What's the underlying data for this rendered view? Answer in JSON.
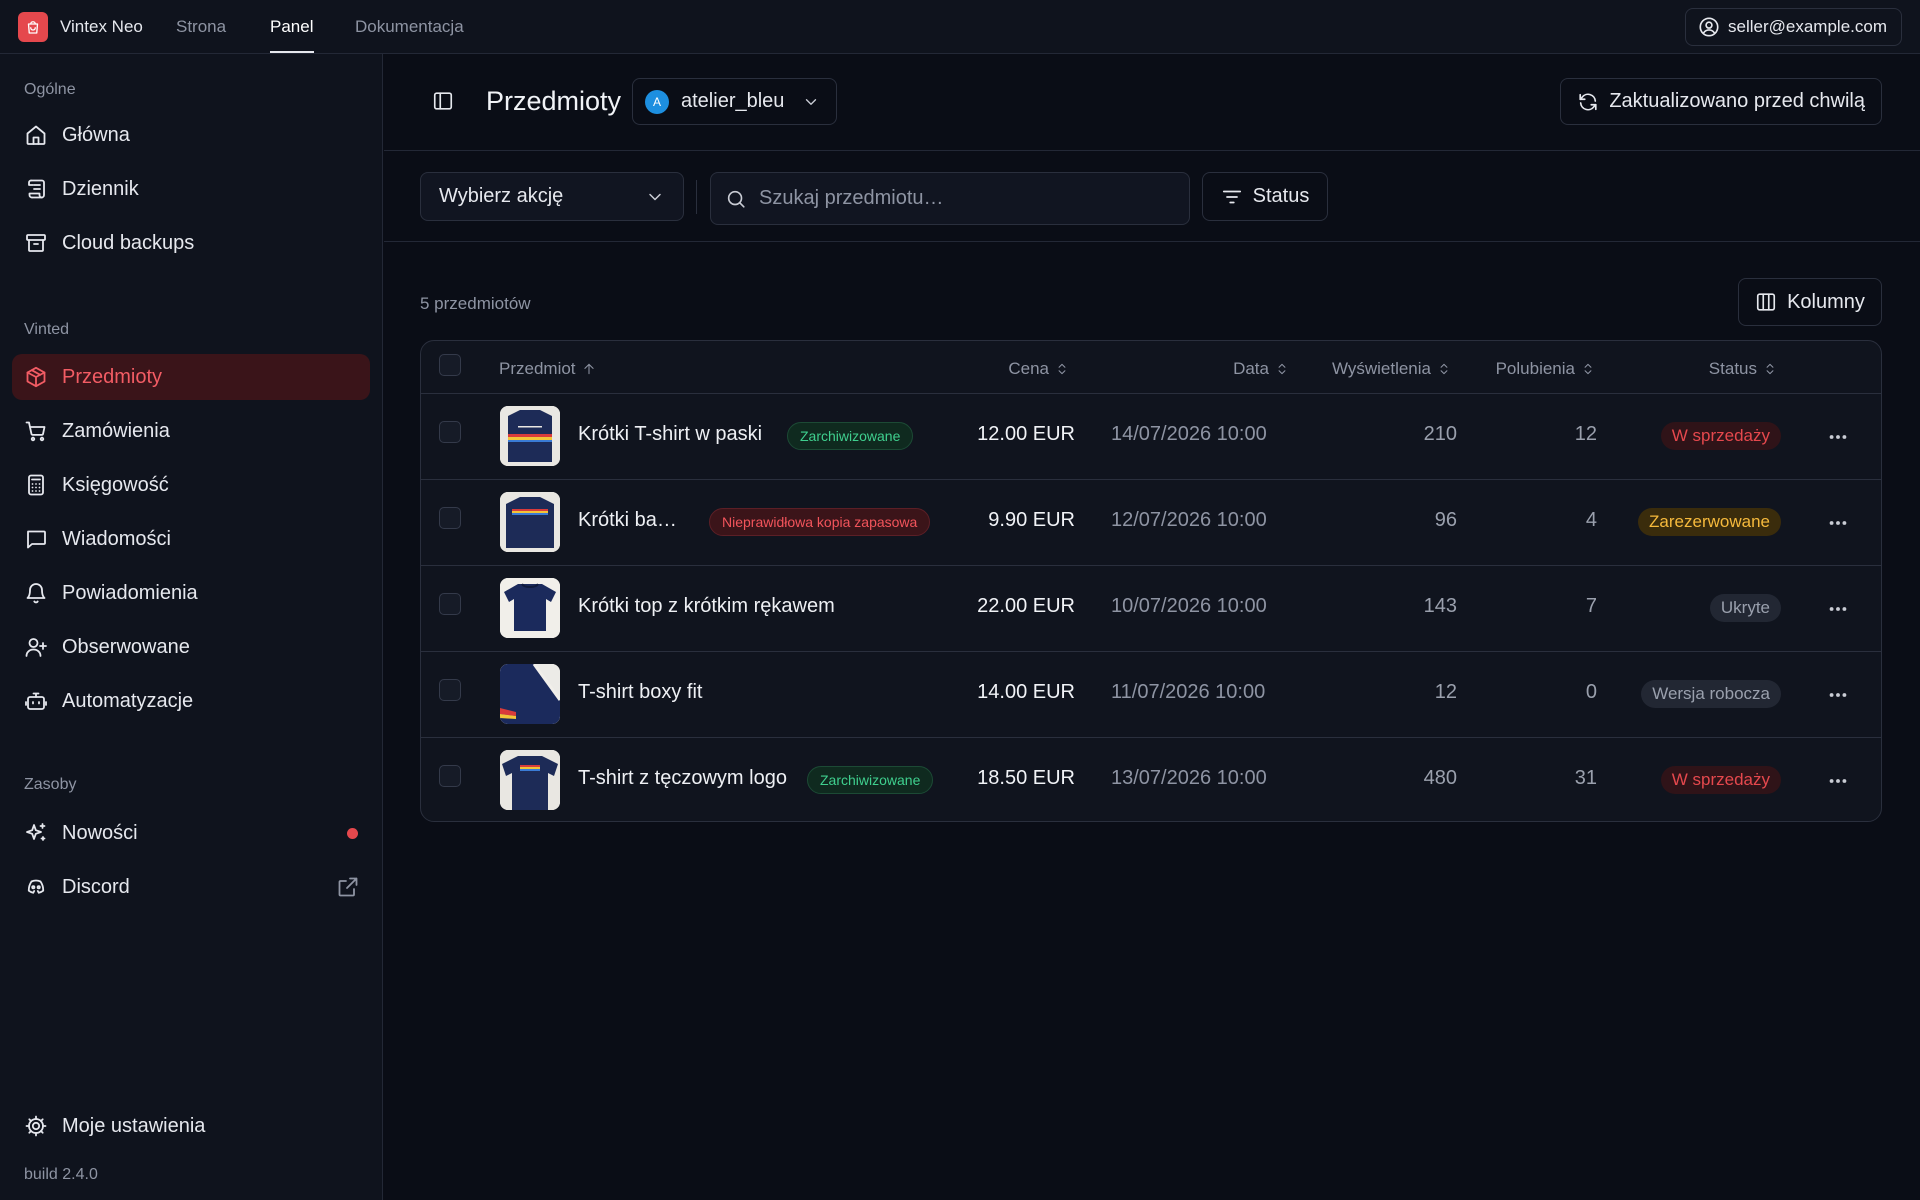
{
  "topbar": {
    "brand": "Vintex Neo",
    "nav": [
      "Strona",
      "Panel",
      "Dokumentacja"
    ],
    "active_nav": "Panel",
    "account": "seller@example.com"
  },
  "sidebar": {
    "sections": [
      {
        "title": "Ogólne",
        "items": [
          "Główna",
          "Dziennik",
          "Cloud backups"
        ]
      },
      {
        "title": "Vinted",
        "items": [
          "Przedmioty",
          "Zamówienia",
          "Księgowość",
          "Wiadomości",
          "Powiadomienia",
          "Obserwowane",
          "Automatyzacje"
        ]
      },
      {
        "title": "Zasoby",
        "items": [
          "Nowości",
          "Discord"
        ]
      }
    ],
    "active_item": "Przedmioty",
    "settings": "Moje ustawienia",
    "build": "build 2.4.0"
  },
  "header": {
    "title": "Przedmioty",
    "account_avatar": "A",
    "account_name": "atelier_bleu",
    "refresh_label": "Zaktualizowano przed chwilą"
  },
  "toolbar": {
    "action_placeholder": "Wybierz akcję",
    "search_placeholder": "Szukaj przedmiotu…",
    "status_label": "Status"
  },
  "list": {
    "count_label": "5 przedmiotów",
    "columns_label": "Kolumny"
  },
  "table": {
    "columns": [
      "Przedmiot",
      "Cena",
      "Data",
      "Wyświetlenia",
      "Polubienia",
      "Status"
    ],
    "rows": [
      {
        "name": "Krótki T-shirt w paski",
        "badge": "Zarchiwizowane",
        "badge_type": "green",
        "price": "12.00 EUR",
        "date": "14/07/2026 10:00",
        "views": "210",
        "likes": "12",
        "status": "W sprzedaży",
        "status_type": "sale"
      },
      {
        "name": "Krótki ba…",
        "badge": "Nieprawidłowa kopia zapasowa",
        "badge_type": "red",
        "price": "9.90 EUR",
        "date": "12/07/2026 10:00",
        "views": "96",
        "likes": "4",
        "status": "Zarezerwowane",
        "status_type": "reserved"
      },
      {
        "name": "Krótki top z krótkim rękawem",
        "badge": "",
        "badge_type": "",
        "price": "22.00 EUR",
        "date": "10/07/2026 10:00",
        "views": "143",
        "likes": "7",
        "status": "Ukryte",
        "status_type": "hidden"
      },
      {
        "name": "T-shirt boxy fit",
        "badge": "",
        "badge_type": "",
        "price": "14.00 EUR",
        "date": "11/07/2026 10:00",
        "views": "12",
        "likes": "0",
        "status": "Wersja robocza",
        "status_type": "draft"
      },
      {
        "name": "T-shirt z tęczowym logo",
        "badge": "Zarchiwizowane",
        "badge_type": "green",
        "price": "18.50 EUR",
        "date": "13/07/2026 10:00",
        "views": "480",
        "likes": "31",
        "status": "W sprzedaży",
        "status_type": "sale"
      }
    ]
  },
  "colors": {
    "accent": "#e5484d",
    "background": "#0a0d16",
    "sidebar": "#0f131d"
  }
}
